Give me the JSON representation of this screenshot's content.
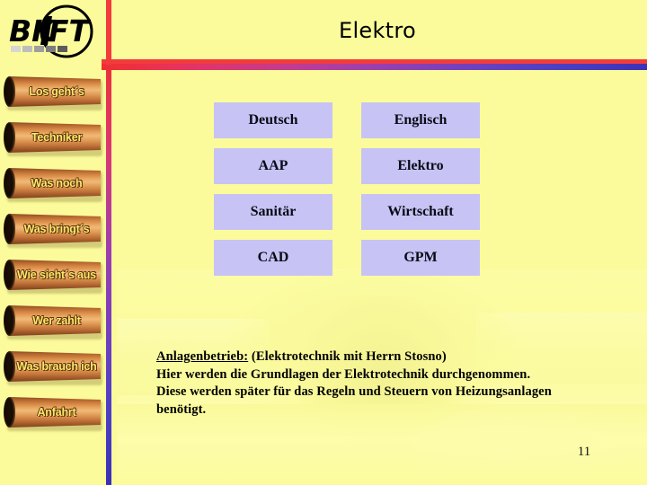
{
  "slide": {
    "title": "Elektro",
    "page_number": "11",
    "background_color": "#fbfb9b",
    "accent_red": "#f23c3c",
    "accent_blue": "#3a2fb6",
    "cell_color": "#c7c3f5"
  },
  "logo": {
    "text": "BKFT",
    "alt": "BKFT logo"
  },
  "sidebar": {
    "items": [
      {
        "label": "Los geht´s"
      },
      {
        "label": "Techniker"
      },
      {
        "label": "Was noch"
      },
      {
        "label": "Was bringt´s"
      },
      {
        "label": "Wie sieht´s aus"
      },
      {
        "label": "Wer zahlt"
      },
      {
        "label": "Was brauch ich"
      },
      {
        "label": "Anfahrt"
      }
    ]
  },
  "table": {
    "rows": [
      {
        "left": "Deutsch",
        "right": "Englisch"
      },
      {
        "left": "AAP",
        "right": "Elektro"
      },
      {
        "left": "Sanitär",
        "right": "Wirtschaft"
      },
      {
        "left": "CAD",
        "right": "GPM"
      }
    ]
  },
  "body": {
    "lead": "Anlagenbetrieb:",
    "lead_rest": " (Elektrotechnik mit Herrn Stosno)",
    "line2": "Hier werden die Grundlagen der Elektrotechnik durchgenommen.",
    "line3": "Diese werden später für das Regeln und Steuern von Heizungsanlagen",
    "line4": "benötigt."
  }
}
